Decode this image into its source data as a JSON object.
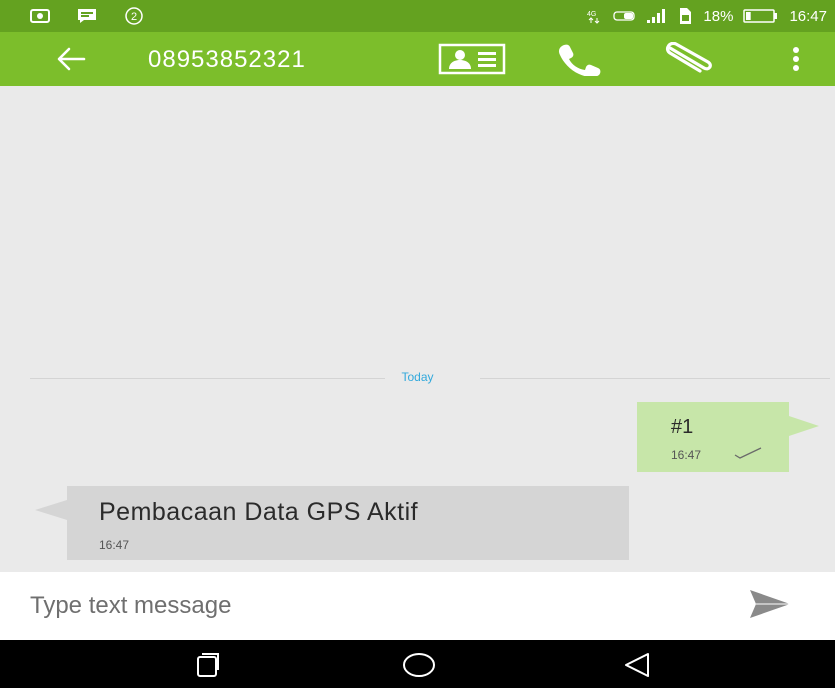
{
  "status_bar": {
    "left_icons": [
      "screenshot-icon",
      "keyboard-icon",
      "notification-count-icon"
    ],
    "notification_count": "2",
    "right_icons": [
      "data-icon",
      "volte-icon",
      "signal-icon",
      "sim-icon"
    ],
    "battery_percent": "18%",
    "battery_level": 0.18,
    "time": "16:47"
  },
  "app_bar": {
    "title": "08953852321",
    "icons": [
      "back-arrow-icon",
      "contact-card-icon",
      "phone-icon",
      "attach-icon",
      "more-vert-icon"
    ],
    "background_color": "#7cbe2b"
  },
  "conversation": {
    "date_divider": "Today",
    "messages": [
      {
        "direction": "outgoing",
        "text": "#1",
        "time": "16:47",
        "status_icon": "sent-check-icon"
      },
      {
        "direction": "incoming",
        "text": "Pembacaan Data GPS Aktif",
        "time": "16:47"
      }
    ]
  },
  "composer": {
    "placeholder": "Type text message",
    "send_icon": "send-icon"
  },
  "nav_bar": {
    "icons": [
      "recents-icon",
      "home-icon",
      "back-icon"
    ]
  },
  "colors": {
    "status_bar": "#64a220",
    "app_bar": "#7cbe2b",
    "outgoing_bubble": "#c7e6a9",
    "incoming_bubble": "#d5d5d5",
    "date_label": "#33a9dc"
  }
}
